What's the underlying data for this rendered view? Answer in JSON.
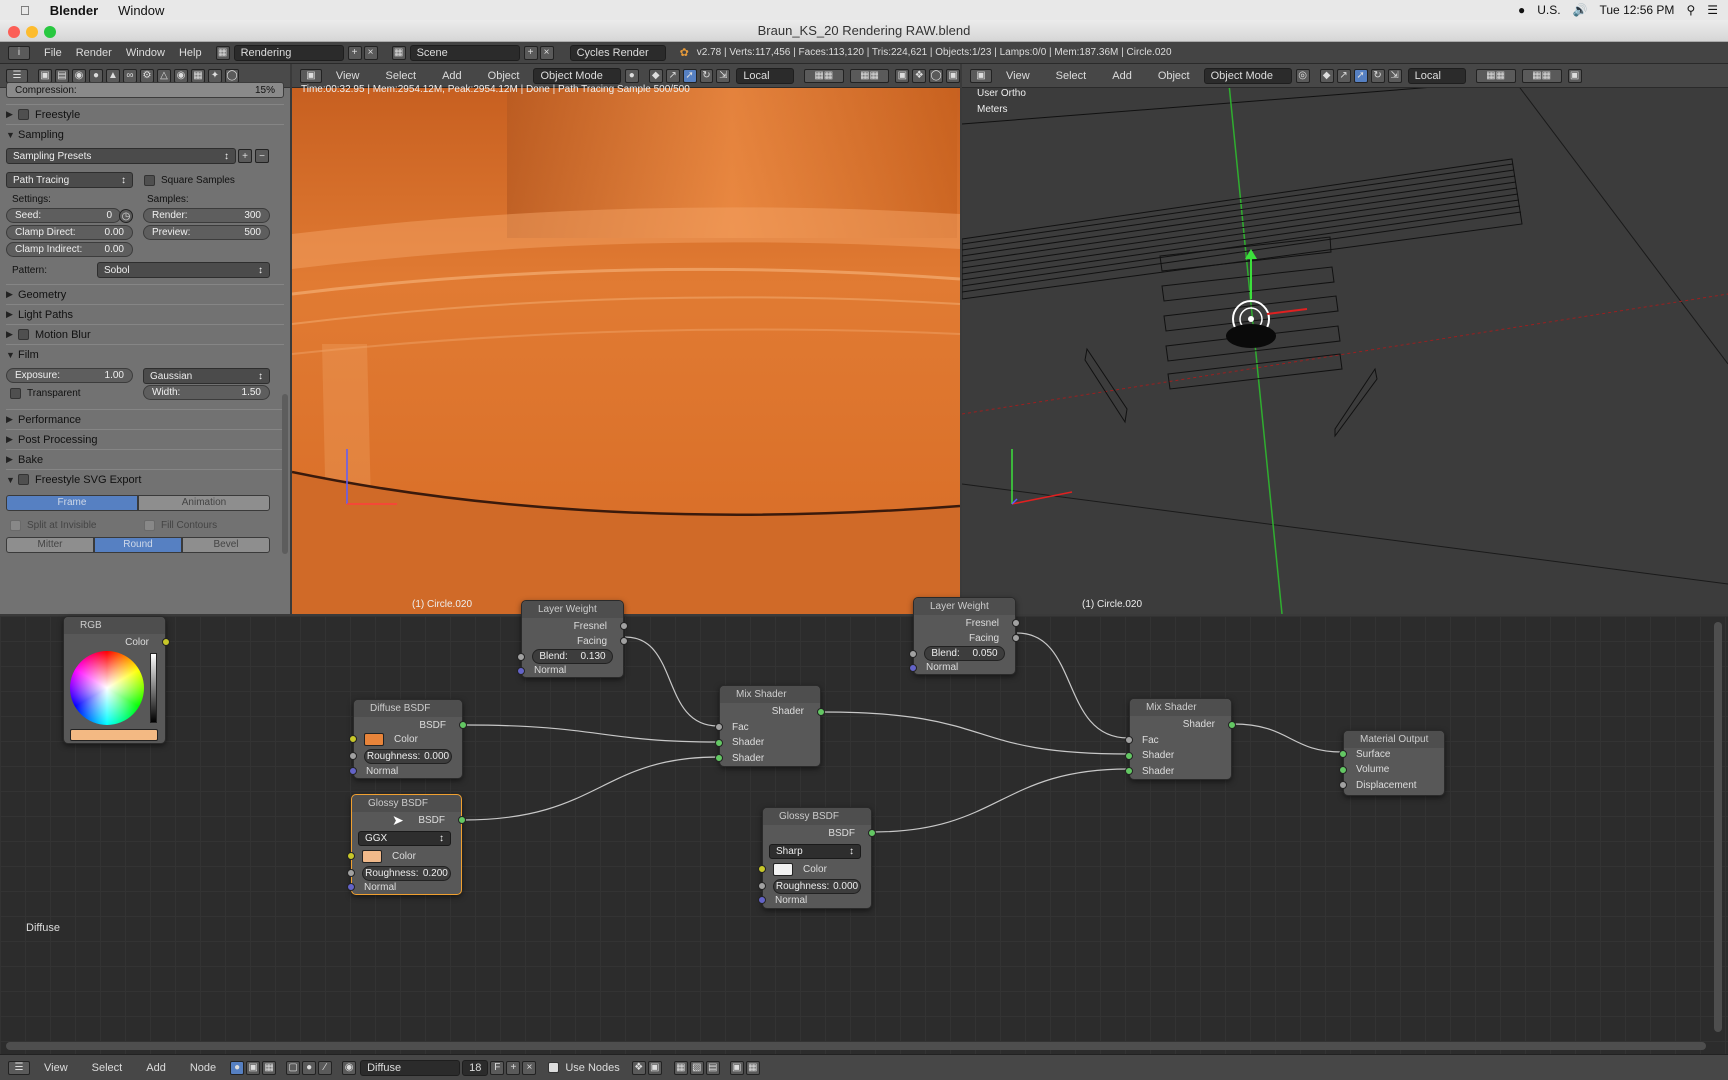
{
  "macbar": {
    "app": "Blender",
    "menu": "Window",
    "keyboard": "U.S.",
    "clock": "Tue 12:56 PM"
  },
  "window": {
    "title": "Braun_KS_20 Rendering RAW.blend"
  },
  "info": {
    "menus": [
      "File",
      "Render",
      "Window",
      "Help"
    ],
    "screen": "Rendering",
    "scene": "Scene",
    "engine": "Cycles Render",
    "stats": "v2.78 | Verts:117,456 | Faces:113,120 | Tris:224,621 | Objects:1/23 | Lamps:0/0 | Mem:187.36M | Circle.020"
  },
  "props": {
    "compression_label": "Compression:",
    "compression_value": "15%",
    "freestyle": "Freestyle",
    "sampling": "Sampling",
    "sampling_presets": "Sampling Presets",
    "integrator": "Path Tracing",
    "square_samples": "Square Samples",
    "settings": "Settings:",
    "samples": "Samples:",
    "seed_l": "Seed:",
    "seed_v": "0",
    "render_l": "Render:",
    "render_v": "300",
    "clamp_direct_l": "Clamp Direct:",
    "clamp_direct_v": "0.00",
    "preview_l": "Preview:",
    "preview_v": "500",
    "clamp_indirect_l": "Clamp Indirect:",
    "clamp_indirect_v": "0.00",
    "pattern_l": "Pattern:",
    "pattern_v": "Sobol",
    "geometry": "Geometry",
    "light_paths": "Light Paths",
    "motion_blur": "Motion Blur",
    "film": "Film",
    "exposure_l": "Exposure:",
    "exposure_v": "1.00",
    "filter": "Gaussian",
    "width_l": "Width:",
    "width_v": "1.50",
    "transparent": "Transparent",
    "performance": "Performance",
    "post_processing": "Post Processing",
    "bake": "Bake",
    "svg_export": "Freestyle SVG Export",
    "frame": "Frame",
    "animation": "Animation",
    "split_invisible": "Split at Invisible",
    "fill_contours": "Fill Contours",
    "mitter": "Mitter",
    "round": "Round",
    "bevel": "Bevel"
  },
  "view_left": {
    "menus": [
      "View",
      "Select",
      "Add",
      "Object"
    ],
    "mode": "Object Mode",
    "orient": "Local",
    "status": "Time:00:32.95 | Mem:2954.12M, Peak:2954.12M | Done | Path Tracing Sample 500/500",
    "object": "(1) Circle.020"
  },
  "view_right": {
    "menus": [
      "View",
      "Select",
      "Add",
      "Object"
    ],
    "mode": "Object Mode",
    "orient": "Local",
    "view_name": "User Ortho",
    "units": "Meters",
    "object": "(1) Circle.020"
  },
  "nodes": {
    "rgb": {
      "title": "RGB",
      "out": "Color",
      "swatch": "#f3b983"
    },
    "lw1": {
      "title": "Layer Weight",
      "fresnel": "Fresnel",
      "facing": "Facing",
      "blend_l": "Blend:",
      "blend_v": "0.130",
      "normal": "Normal"
    },
    "lw2": {
      "title": "Layer Weight",
      "fresnel": "Fresnel",
      "facing": "Facing",
      "blend_l": "Blend:",
      "blend_v": "0.050",
      "normal": "Normal"
    },
    "diffuse": {
      "title": "Diffuse BSDF",
      "out": "BSDF",
      "color": "Color",
      "rough_l": "Roughness:",
      "rough_v": "0.000",
      "normal": "Normal",
      "swatch": "#e8843a"
    },
    "glossy1": {
      "title": "Glossy BSDF",
      "out": "BSDF",
      "dist": "GGX",
      "color": "Color",
      "rough_l": "Roughness:",
      "rough_v": "0.200",
      "normal": "Normal",
      "swatch": "#f1b98a"
    },
    "glossy2": {
      "title": "Glossy BSDF",
      "out": "BSDF",
      "dist": "Sharp",
      "color": "Color",
      "rough_l": "Roughness:",
      "rough_v": "0.000",
      "normal": "Normal",
      "swatch": "#f2f2f2"
    },
    "mix1": {
      "title": "Mix Shader",
      "out": "Shader",
      "fac": "Fac",
      "in1": "Shader",
      "in2": "Shader"
    },
    "mix2": {
      "title": "Mix Shader",
      "out": "Shader",
      "fac": "Fac",
      "in1": "Shader",
      "in2": "Shader"
    },
    "output": {
      "title": "Material Output",
      "surface": "Surface",
      "volume": "Volume",
      "displacement": "Displacement"
    },
    "active_label": "Diffuse"
  },
  "bottom": {
    "menus": [
      "View",
      "Select",
      "Add",
      "Node"
    ],
    "material": "Diffuse",
    "users": "18",
    "fake": "F",
    "use_nodes": "Use Nodes"
  }
}
